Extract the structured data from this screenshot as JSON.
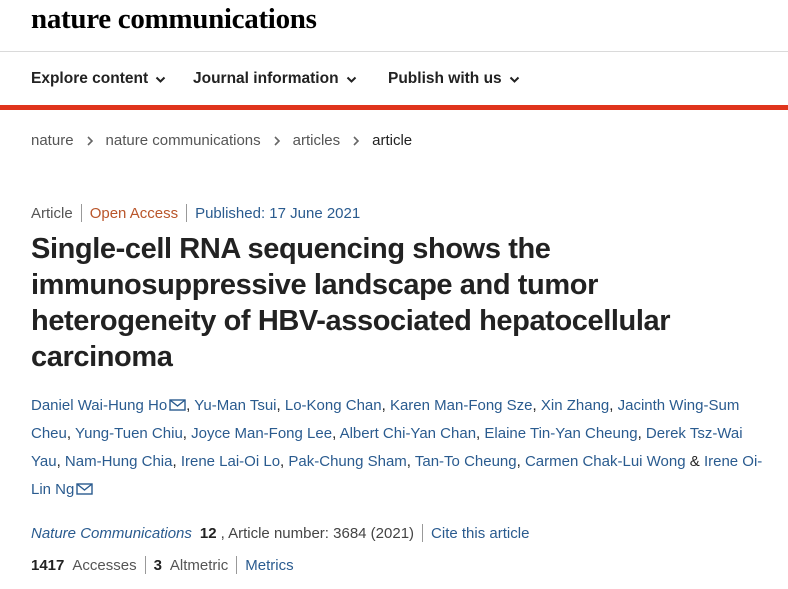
{
  "masthead": {
    "logo_text": "nature communications"
  },
  "nav": {
    "items": [
      {
        "label": "Explore content"
      },
      {
        "label": "Journal information"
      },
      {
        "label": "Publish with us"
      }
    ]
  },
  "breadcrumb": [
    "nature",
    "nature communications",
    "articles",
    "article"
  ],
  "article": {
    "type": "Article",
    "access": "Open Access",
    "published": "Published: 17 June 2021",
    "title": "Single-cell RNA sequencing shows the immunosuppressive landscape and tumor heterogeneity of HBV-associated hepatocellular carcinoma",
    "authors": [
      "Daniel Wai-Hung Ho",
      "Yu-Man Tsui",
      "Lo-Kong Chan",
      "Karen Man-Fong Sze",
      "Xin Zhang",
      "Jacinth Wing-Sum Cheu",
      "Yung-Tuen Chiu",
      "Joyce Man-Fong Lee",
      "Albert Chi-Yan Chan",
      "Elaine Tin-Yan Cheung",
      "Derek Tsz-Wai Yau",
      "Nam-Hung Chia",
      "Irene Lai-Oi Lo",
      "Pak-Chung Sham",
      "Tan-To Cheung",
      "Carmen Chak-Lui Wong",
      "Irene Oi-Lin Ng"
    ],
    "and_text": "&"
  },
  "citation": {
    "journal": "Nature Communications",
    "volume": "12",
    "article_number": ", Article number: 3684 (2021)",
    "cite_label": "Cite this article"
  },
  "stats": {
    "accesses_count": "1417",
    "accesses_label": "Accesses",
    "altmetric_count": "3",
    "altmetric_label": "Altmetric",
    "metrics_label": "Metrics"
  },
  "colors": {
    "accent_red": "#e0341c",
    "link_blue": "#2a5b8f",
    "open_access_orange": "#b9552a"
  }
}
